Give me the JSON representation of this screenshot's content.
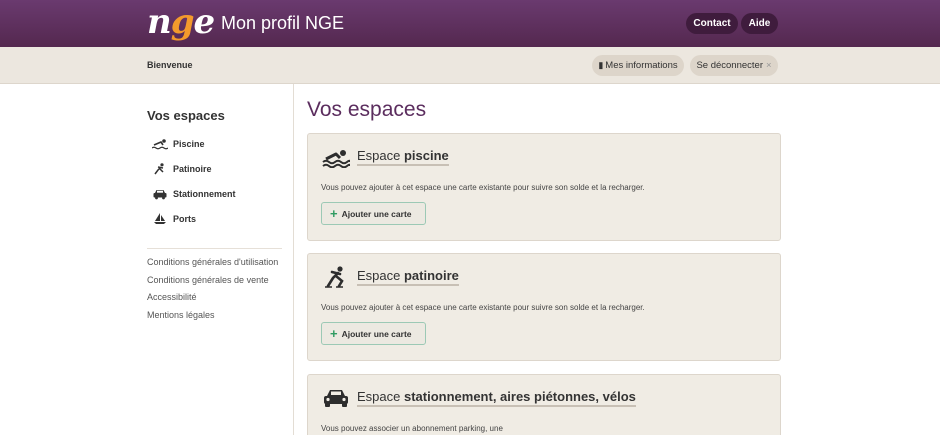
{
  "header": {
    "logo_text_prefix": "n",
    "logo_text_g": "g",
    "logo_text_suffix": "e",
    "title": "Mon profil NGE",
    "contact_label": "Contact",
    "aide_label": "Aide"
  },
  "subbar": {
    "welcome": "Bienvenue",
    "mes_informations_label": "Mes informations",
    "logout_label": "Se déconnecter",
    "logout_icon": "×"
  },
  "sidebar": {
    "title": "Vos espaces",
    "items": [
      {
        "label": "Piscine",
        "icon": "swimmer-icon"
      },
      {
        "label": "Patinoire",
        "icon": "skater-icon"
      },
      {
        "label": "Stationnement",
        "icon": "car-icon"
      },
      {
        "label": "Ports",
        "icon": "sailboat-icon"
      }
    ],
    "links": [
      "Conditions générales d'utilisation",
      "Conditions générales de vente",
      "Accessibilité",
      "Mentions légales"
    ]
  },
  "main": {
    "title": "Vos espaces",
    "cards": [
      {
        "prefix": "Espace ",
        "name": "piscine",
        "text": "Vous pouvez ajouter à cet espace une carte existante pour suivre son solde et la recharger.",
        "button": "Ajouter une carte"
      },
      {
        "prefix": "Espace ",
        "name": "patinoire",
        "text": "Vous pouvez ajouter à cet espace une carte existante pour suivre son solde et la recharger.",
        "button": "Ajouter une carte"
      },
      {
        "prefix": "Espace ",
        "name": "stationnement, aires piétonnes, vélos",
        "text": "Vous pouvez associer un abonnement parking, une"
      }
    ]
  },
  "colors": {
    "header_purple": "#5e2f5c",
    "title_purple": "#5b2d5e",
    "logo_orange": "#f39a2c",
    "add_green": "#2e9b62"
  }
}
